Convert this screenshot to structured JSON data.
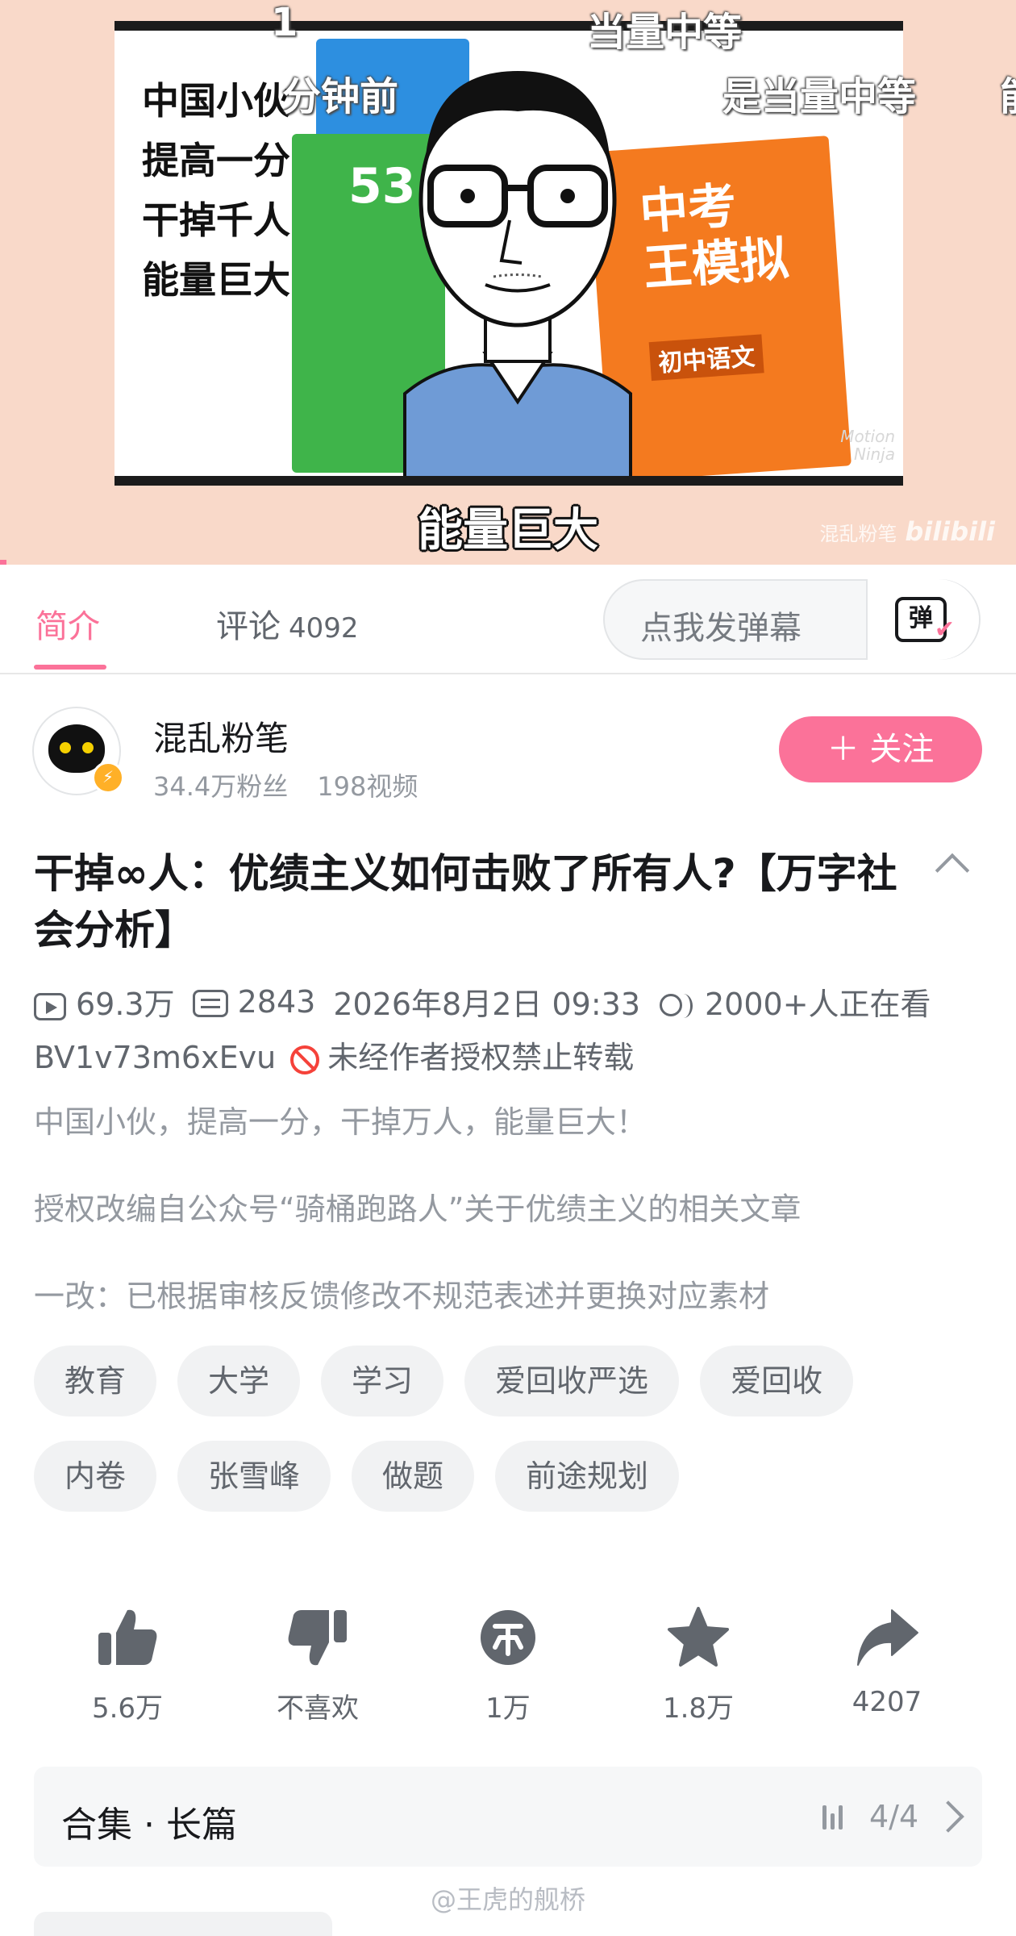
{
  "player": {
    "frame_lines": [
      "中国小伙",
      "提高一分",
      "干掉千人",
      "能量巨大"
    ],
    "book_green_text": "53",
    "book_orange_title": "中考",
    "book_orange_sub": "王模拟",
    "book_orange_label": "初中语文",
    "motion_ninja": "Motion\nNinja",
    "danmaku": [
      "1",
      "当量中等",
      "分钟前",
      "是当量中等",
      "能"
    ],
    "subtitle": "能量巨大",
    "bili_author": "混乱粉笔",
    "bili_logo": "bilibili"
  },
  "tabs": {
    "intro": "简介",
    "comments": "评论",
    "comments_count": "4092",
    "danmaku_placeholder": "点我发弹幕",
    "danmaku_button": "弹"
  },
  "uploader": {
    "name": "混乱粉笔",
    "fans": "34.4万粉丝",
    "videos": "198视频",
    "follow_label": "＋ 关注"
  },
  "video": {
    "title": "干掉∞人：优绩主义如何击败了所有人?【万字社会分析】",
    "views": "69.3万",
    "danmaku_count": "2843",
    "date": "2026年8月2日 09:33",
    "watching": "2000+人正在看",
    "bvid": "BV1v73m6xEvu",
    "no_repost": "未经作者授权禁止转载",
    "desc_lines": [
      "中国小伙，提高一分，干掉万人，能量巨大！",
      "授权改编自公众号“骑桶跑路人”关于优绩主义的相关文章",
      "一改：已根据审核反馈修改不规范表述并更换对应素材"
    ]
  },
  "tags_row1": [
    "教育",
    "大学",
    "学习",
    "爱回收严选",
    "爱回收"
  ],
  "tags_row2": [
    "内卷",
    "张雪峰",
    "做题",
    "前途规划"
  ],
  "actions": {
    "like": "5.6万",
    "dislike": "不喜欢",
    "coin": "1万",
    "favorite": "1.8万",
    "share": "4207"
  },
  "collection": {
    "name": "合集 · 长篇",
    "progress": "4/4"
  },
  "watermark": "@王虎的舰桥",
  "colors": {
    "accent": "#fb7299",
    "player_bg": "#f9d9c9",
    "text_primary": "#18191c",
    "text_secondary": "#61666d",
    "text_tertiary": "#9499a0",
    "icon_gray": "#61666d"
  }
}
